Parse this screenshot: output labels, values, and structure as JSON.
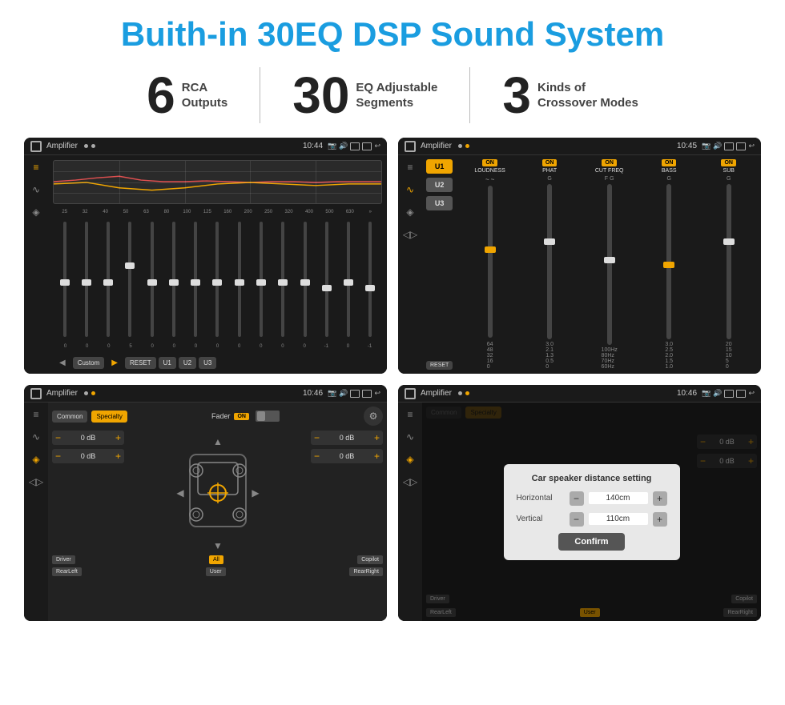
{
  "header": {
    "title": "Buith-in 30EQ DSP Sound System"
  },
  "stats": [
    {
      "number": "6",
      "label": "RCA\nOutputs"
    },
    {
      "number": "30",
      "label": "EQ Adjustable\nSegments"
    },
    {
      "number": "3",
      "label": "Kinds of\nCrossover Modes"
    }
  ],
  "screens": [
    {
      "id": "eq-screen",
      "title": "Amplifier",
      "time": "10:44",
      "description": "30-band EQ screen"
    },
    {
      "id": "crossover-screen",
      "title": "Amplifier",
      "time": "10:45",
      "description": "Crossover modes screen"
    },
    {
      "id": "fader-screen",
      "title": "Amplifier",
      "time": "10:46",
      "description": "Fader speaker screen"
    },
    {
      "id": "dialog-screen",
      "title": "Amplifier",
      "time": "10:46",
      "description": "Speaker distance dialog"
    }
  ],
  "eq": {
    "frequencies": [
      "25",
      "32",
      "40",
      "50",
      "63",
      "80",
      "100",
      "125",
      "160",
      "200",
      "250",
      "320",
      "400",
      "500",
      "630"
    ],
    "values": [
      "0",
      "0",
      "0",
      "5",
      "0",
      "0",
      "0",
      "0",
      "0",
      "0",
      "0",
      "0",
      "-1",
      "0",
      "-1"
    ],
    "bottom_buttons": [
      "◀",
      "Custom",
      "▶",
      "RESET",
      "U1",
      "U2",
      "U3"
    ]
  },
  "crossover": {
    "u_buttons": [
      "U1",
      "U2",
      "U3"
    ],
    "channels": [
      {
        "name": "LOUDNESS",
        "on": true
      },
      {
        "name": "PHAT",
        "on": true
      },
      {
        "name": "CUT FREQ",
        "on": true
      },
      {
        "name": "BASS",
        "on": true
      },
      {
        "name": "SUB",
        "on": true
      }
    ],
    "reset_label": "RESET"
  },
  "fader": {
    "common_label": "Common",
    "specialty_label": "Specialty",
    "fader_label": "Fader",
    "on_label": "ON",
    "db_values": [
      "0 dB",
      "0 dB",
      "0 dB",
      "0 dB"
    ],
    "bottom_labels": [
      "Driver",
      "All",
      "Copilot",
      "RearLeft",
      "User",
      "RearRight"
    ]
  },
  "dialog": {
    "title": "Car speaker distance setting",
    "horizontal_label": "Horizontal",
    "horizontal_value": "140cm",
    "vertical_label": "Vertical",
    "vertical_value": "110cm",
    "confirm_label": "Confirm",
    "db_right_values": [
      "0 dB",
      "0 dB"
    ],
    "bottom_labels": [
      "Driver",
      "Copilot",
      "RearLeft",
      "User",
      "RearRight"
    ]
  }
}
